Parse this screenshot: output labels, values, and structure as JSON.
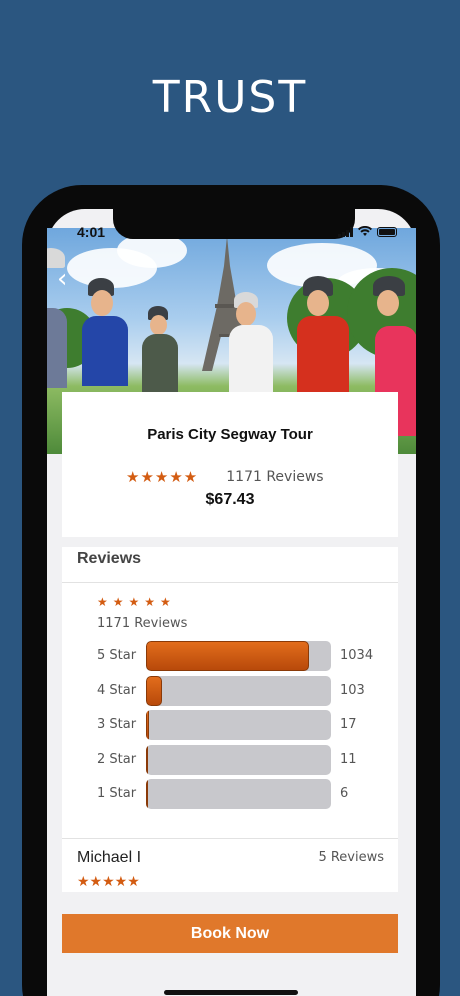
{
  "headline": "TRUST",
  "status_bar": {
    "time": "4:01"
  },
  "tour": {
    "title": "Paris City Segway Tour",
    "rating_stars": "★★★★★",
    "reviews_count_label": "1171 Reviews",
    "price": "$67.43"
  },
  "reviews": {
    "heading": "Reviews",
    "summary_stars": "★★★★★",
    "summary_count": "1171 Reviews",
    "total": 1171,
    "distribution": [
      {
        "label": "5 Star",
        "count": "1034",
        "fraction": 0.883
      },
      {
        "label": "4 Star",
        "count": "103",
        "fraction": 0.088
      },
      {
        "label": "3 Star",
        "count": "17",
        "fraction": 0.015
      },
      {
        "label": "2 Star",
        "count": "11",
        "fraction": 0.009
      },
      {
        "label": "1 Star",
        "count": "6",
        "fraction": 0.005
      }
    ],
    "bar_fill_color": "#cf5d12"
  },
  "reviewer": {
    "name": "Michael I",
    "reviews_label": "5 Reviews",
    "stars": "★★★★★"
  },
  "book_button": {
    "label": "Book Now",
    "color": "#e0782b"
  },
  "icons": [
    "back-chevron-icon",
    "signal-icon",
    "wifi-icon",
    "battery-icon",
    "star-icon"
  ]
}
